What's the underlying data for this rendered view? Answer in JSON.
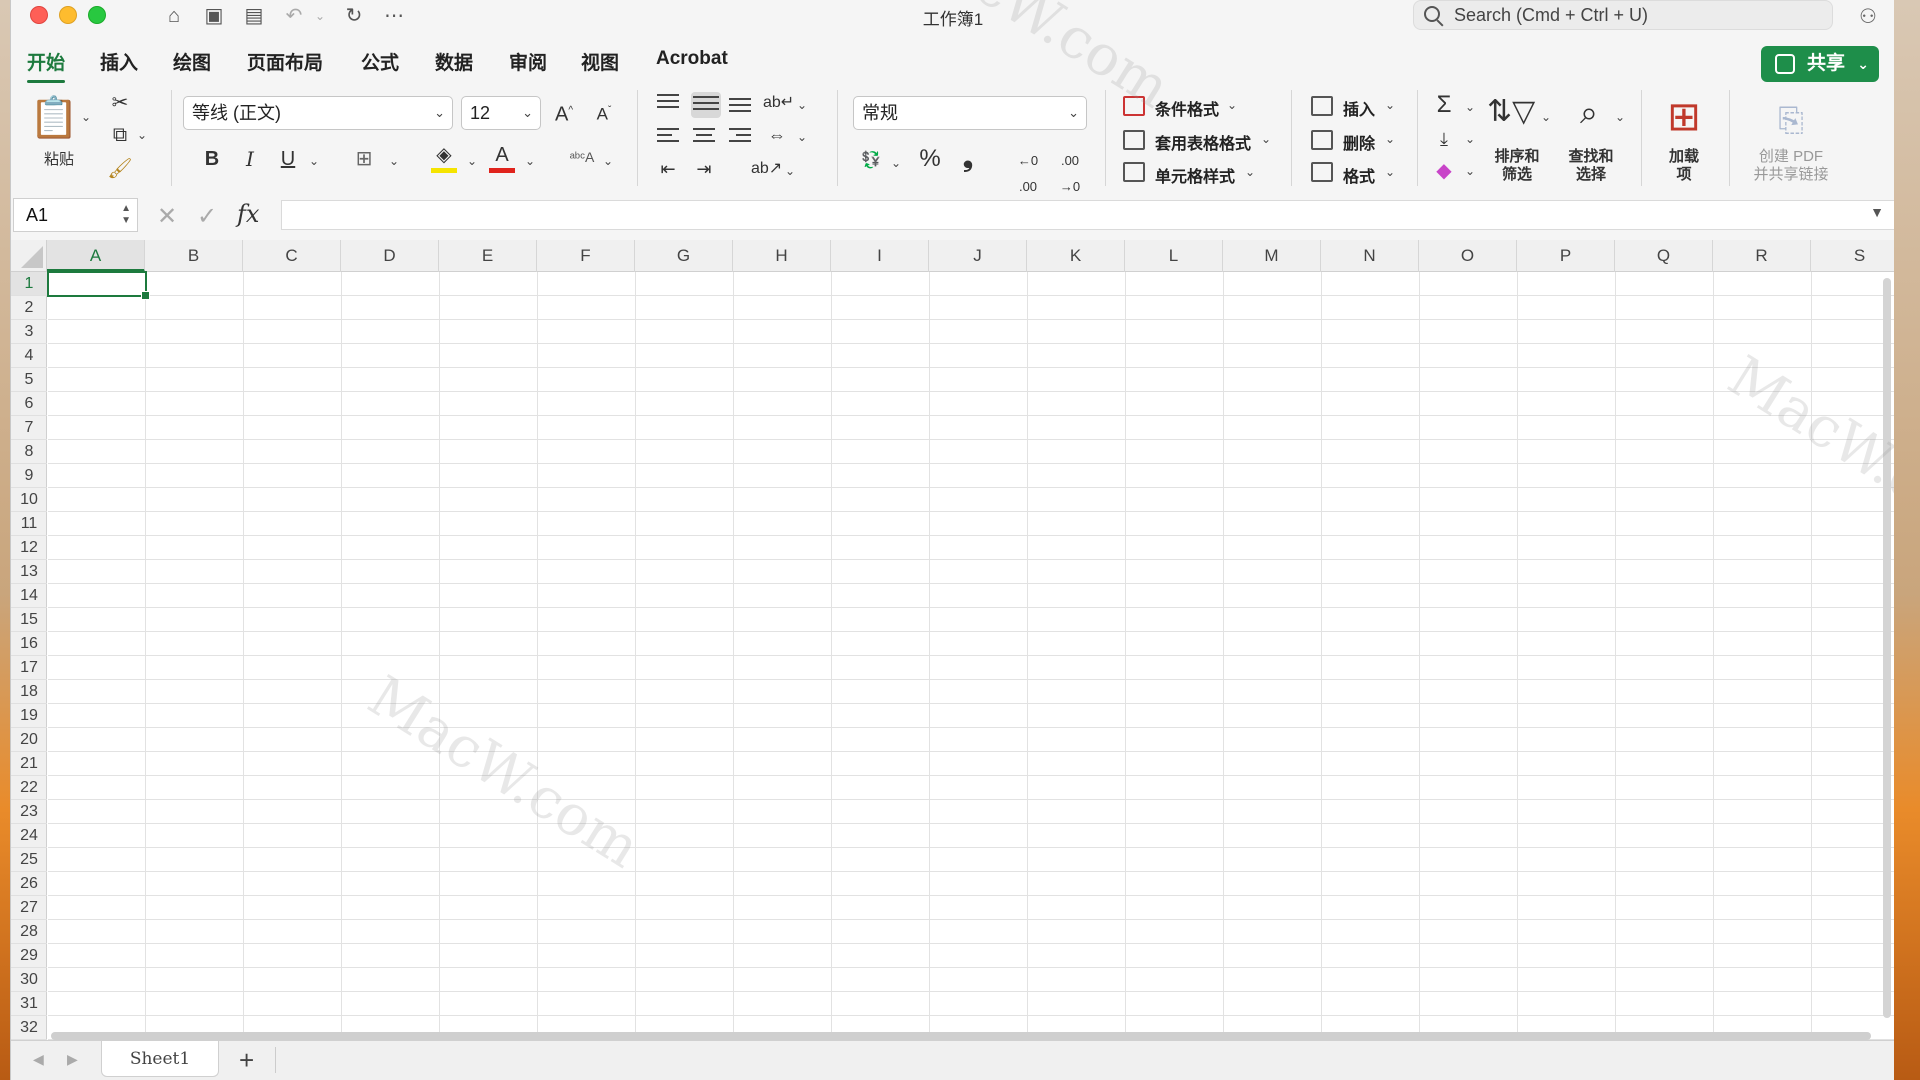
{
  "window": {
    "title": "工作簿1",
    "search_placeholder": "Search (Cmd + Ctrl + U)"
  },
  "tabs": [
    "开始",
    "插入",
    "绘图",
    "页面布局",
    "公式",
    "数据",
    "审阅",
    "视图",
    "Acrobat"
  ],
  "active_tab": "开始",
  "share_label": "共享",
  "ribbon": {
    "paste_label": "粘贴",
    "font_name": "等线 (正文)",
    "font_size": "12",
    "bold": "B",
    "italic": "I",
    "underline": "U",
    "number_format": "常规",
    "conditional_format": "条件格式",
    "table_format": "套用表格格式",
    "cell_style": "单元格样式",
    "insert": "插入",
    "delete": "删除",
    "format": "格式",
    "sort_filter_1": "排序和",
    "sort_filter_2": "筛选",
    "find_select_1": "查找和",
    "find_select_2": "选择",
    "addins_1": "加载",
    "addins_2": "项",
    "create_pdf_1": "创建 PDF",
    "create_pdf_2": "并共享链接",
    "percent": "%",
    "comma": "❟",
    "accent_color": "#1d7a3e"
  },
  "formula_bar": {
    "name_box": "A1",
    "fx": "fx",
    "value": ""
  },
  "grid": {
    "columns": [
      "A",
      "B",
      "C",
      "D",
      "E",
      "F",
      "G",
      "H",
      "I",
      "J",
      "K",
      "L",
      "M",
      "N",
      "O",
      "P",
      "Q",
      "R",
      "S"
    ],
    "rows": [
      "1",
      "2",
      "3",
      "4",
      "5",
      "6",
      "7",
      "8",
      "9",
      "10",
      "11",
      "12",
      "13",
      "14",
      "15",
      "16",
      "17",
      "18",
      "19",
      "20",
      "21",
      "22",
      "23",
      "24",
      "25",
      "26",
      "27",
      "28",
      "29",
      "30",
      "31",
      "32"
    ],
    "active_cell": "A1"
  },
  "sheets": [
    "Sheet1"
  ],
  "watermark": "MacW.com"
}
